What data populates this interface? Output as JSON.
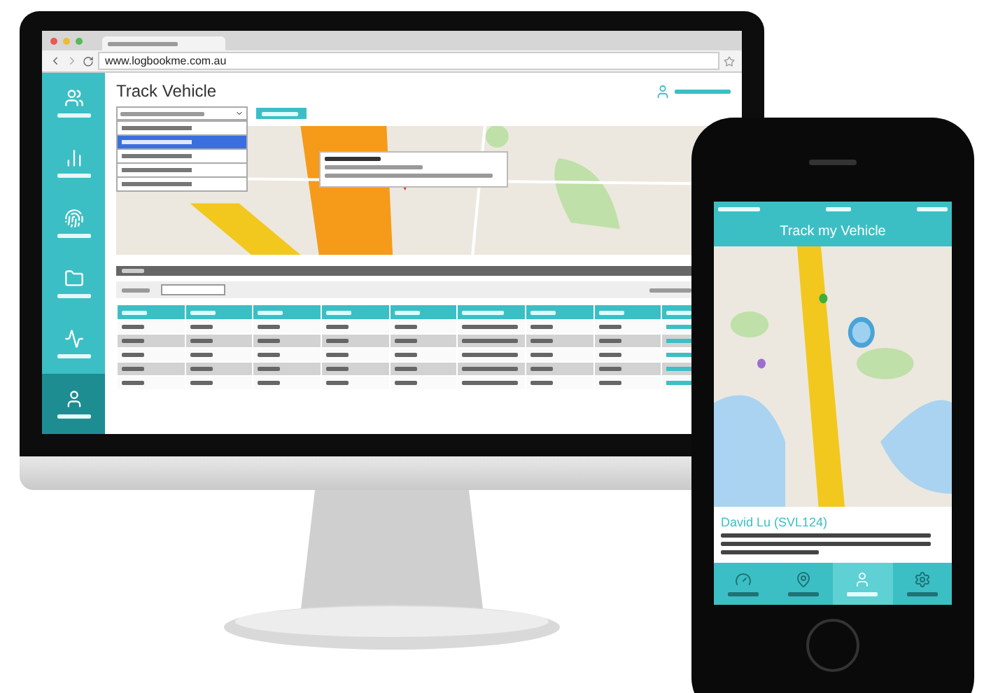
{
  "monitor": {
    "browser": {
      "url": "www.logbookme.com.au"
    },
    "sidebar": {
      "items": [
        {
          "selected": false
        },
        {
          "selected": false
        },
        {
          "selected": false
        },
        {
          "selected": false
        },
        {
          "selected": false
        },
        {
          "selected": true
        }
      ]
    },
    "page": {
      "title": "Track Vehicle",
      "vehicle_options": [
        {
          "selected": false
        },
        {
          "selected": true
        },
        {
          "selected": false
        },
        {
          "selected": false
        },
        {
          "selected": false
        }
      ],
      "table": {
        "rows": [
          {
            "striped": false
          },
          {
            "striped": true
          },
          {
            "striped": false
          },
          {
            "striped": true
          },
          {
            "striped": false
          }
        ]
      }
    }
  },
  "phone": {
    "title": "Track my Vehicle",
    "card": {
      "name": "David Lu (SVL124)"
    },
    "tabs": [
      {
        "selected": false
      },
      {
        "selected": false
      },
      {
        "selected": true
      },
      {
        "selected": false
      }
    ]
  }
}
